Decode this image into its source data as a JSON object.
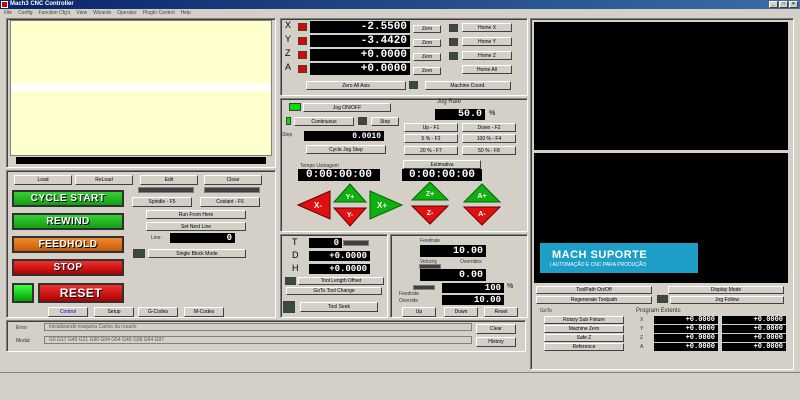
{
  "window": {
    "title": "Mach3 CNC Controller",
    "buttons": [
      "_",
      "□",
      "×"
    ]
  },
  "menu": [
    "File",
    "Config",
    "Function Cfg's",
    "View",
    "Wizards",
    "Operator",
    "PlugIn Control",
    "Help"
  ],
  "axes": {
    "labels": [
      "X",
      "Y",
      "Z",
      "A"
    ],
    "values": [
      "-2.5500",
      "-3.4420",
      "+0.0000",
      "+0.0000"
    ],
    "zero_labels": [
      "Zero",
      "Zero",
      "Zero",
      "Zero"
    ],
    "home_labels": [
      "Home X",
      "Home Y",
      "Home Z",
      "Home All"
    ],
    "zero_all": "Zero All Axis",
    "machine_coord": "Machine Coord."
  },
  "jog": {
    "toggle": "Jog ON/OFF",
    "continuous": "Continuous",
    "step": "Step",
    "step_label": "Step",
    "step_value": "0.0010",
    "cycle_jog": "Cycle Jog Step",
    "rate_label": "Jog Rate",
    "rate_value": "50.0",
    "rate_unit": "%",
    "presets": [
      "Up - F1",
      "Down - F2",
      "5 % - F3",
      "100 % - F4",
      "20 % - F7",
      "50 % - F8"
    ],
    "time_label": "Tempo Usinagem",
    "time_value": "0:00:00:00",
    "estimate": "Estimativa",
    "estimate_value": "0:00:00:00",
    "arrows": [
      "X-",
      "Y+",
      "Y-",
      "X+",
      "Z+",
      "Z-",
      "A+",
      "A-"
    ]
  },
  "file_buttons": [
    "Load",
    "ReLoad",
    "Edit",
    "Close"
  ],
  "controls": {
    "cycle_start": "CYCLE START",
    "rewind": "REWIND",
    "feedhold": "FEEDHOLD",
    "stop": "STOP",
    "reset": "RESET",
    "spindle": "Spindle - F5",
    "coolant": "Coolant - F6",
    "run_from_here": "Run From Here",
    "set_next_line": "Set Next Line",
    "line_label": "Line:",
    "line_value": "0",
    "single_block": "Single Block Mode"
  },
  "tabs": [
    "Control",
    "Setup",
    "G-Codes",
    "M-Codes"
  ],
  "tool": {
    "labels": [
      "T",
      "D",
      "H"
    ],
    "values": [
      "0",
      "+0.0000",
      "+0.0000"
    ],
    "length_offset": "Tool Length Offset",
    "goto_change": "GoTo Tool Change",
    "tool_seek": "Tool Seek"
  },
  "feed": {
    "feedrate_label": "Feedrate",
    "feedrate_value": "10.00",
    "velocity_label": "Velocity",
    "overrides_label": "Overrides",
    "velocity_value": "0.00",
    "override_pct": "100",
    "override_unit": "%",
    "override_label": "Override",
    "override_value": "10.00",
    "feedrate2_label": "Feedrate",
    "buttons": [
      "Up",
      "Down",
      "Reset"
    ]
  },
  "status": {
    "error_label": "Error",
    "error_text": "Inicializando maquina Carlos da rosario",
    "mode_label": "Modal",
    "mode_text": "G0 G17 G40 G21 G90 G94 G54 G49 G99 G64 G97",
    "clear": "Clear",
    "history": "History"
  },
  "right": {
    "logo_title": "MACH SUPORTE",
    "logo_sub": "| AUTOMAÇÃO E CNC PARA PRODUÇÃO",
    "toolpath": "ToolPath On/Off",
    "regenerate": "Regenerate Toolpath",
    "display_mode": "Display Mode",
    "jog_follow": "Jog Follow",
    "goto_label": "GoTo",
    "goto_buttons": [
      "Rotary Sub Fixture",
      "Machine Zero",
      "Safe Z",
      "Reference"
    ],
    "prog_extents": "Program Extents",
    "ext_axes": [
      "X",
      "Y",
      "Z",
      "A"
    ],
    "ext_min": [
      "+0.0000",
      "+0.0000",
      "+0.0000",
      "+0.0000"
    ],
    "ext_max": [
      "+0.0000",
      "+0.0000",
      "+0.0000",
      "+0.0000"
    ]
  },
  "colors": {
    "dro_bg": "#000000",
    "led_red": "#e00000",
    "led_green": "#00e000",
    "gcode_bg": "#ffffcc",
    "logo_bg": "#1e9fc8"
  }
}
